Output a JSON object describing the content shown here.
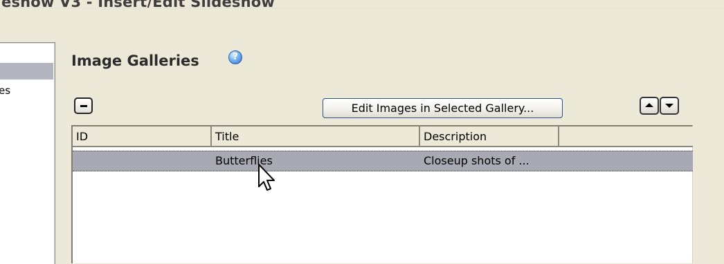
{
  "window": {
    "title": "eshow V3 - Insert/Edit Slideshow"
  },
  "left_panel": {
    "items": [
      {
        "label": ""
      },
      {
        "label": "es"
      }
    ]
  },
  "main": {
    "heading": "Image Galleries",
    "help_icon": "help-circle-icon",
    "toolbar": {
      "remove_icon": "minus-icon",
      "edit_button_label": "Edit Images in Selected Gallery...",
      "move_up_icon": "arrow-up-icon",
      "move_down_icon": "arrow-down-icon"
    },
    "table": {
      "columns": [
        "ID",
        "Title",
        "Description"
      ],
      "rows": [
        {
          "id": "",
          "title": "Butterflies",
          "description": "Closeup shots of ...",
          "selected": true
        }
      ]
    }
  },
  "colors": {
    "background": "#ece9d8",
    "selected_row": "#a9a9b4",
    "help_icon": "#2f6fc8"
  }
}
